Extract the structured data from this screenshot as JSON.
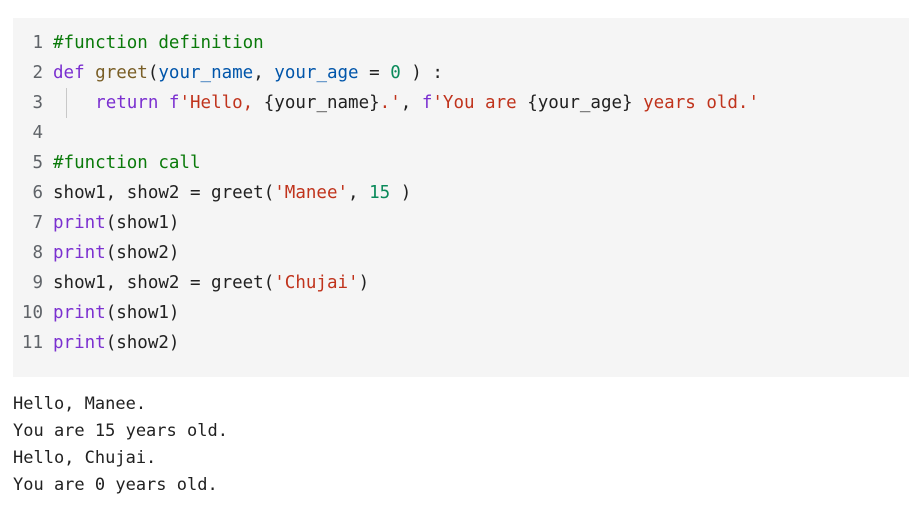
{
  "code_lines": [
    {
      "num": "1",
      "tokens": [
        [
          "comment",
          "#function definition"
        ]
      ]
    },
    {
      "num": "2",
      "tokens": [
        [
          "keyword",
          "def "
        ],
        [
          "func",
          "greet"
        ],
        [
          "plain",
          "("
        ],
        [
          "param",
          "your_name"
        ],
        [
          "plain",
          ", "
        ],
        [
          "param",
          "your_age"
        ],
        [
          "plain",
          " = "
        ],
        [
          "number",
          "0"
        ],
        [
          "plain",
          " ) :"
        ]
      ]
    },
    {
      "num": "3",
      "indent": true,
      "tokens": [
        [
          "plain",
          "    "
        ],
        [
          "keyword",
          "return "
        ],
        [
          "keyword",
          "f"
        ],
        [
          "string",
          "'Hello, "
        ],
        [
          "plain",
          "{your_name}"
        ],
        [
          "string",
          ".'"
        ],
        [
          "plain",
          ", "
        ],
        [
          "keyword",
          "f"
        ],
        [
          "string",
          "'You are "
        ],
        [
          "plain",
          "{your_age}"
        ],
        [
          "string",
          " years old.'"
        ]
      ]
    },
    {
      "num": "4",
      "tokens": []
    },
    {
      "num": "5",
      "tokens": [
        [
          "comment",
          "#function call"
        ]
      ]
    },
    {
      "num": "6",
      "tokens": [
        [
          "plain",
          "show1, show2 = greet("
        ],
        [
          "string",
          "'Manee'"
        ],
        [
          "plain",
          ", "
        ],
        [
          "number",
          "15"
        ],
        [
          "plain",
          " )"
        ]
      ]
    },
    {
      "num": "7",
      "tokens": [
        [
          "builtin",
          "print"
        ],
        [
          "plain",
          "(show1)"
        ]
      ]
    },
    {
      "num": "8",
      "tokens": [
        [
          "builtin",
          "print"
        ],
        [
          "plain",
          "(show2)"
        ]
      ]
    },
    {
      "num": "9",
      "tokens": [
        [
          "plain",
          "show1, show2 = greet("
        ],
        [
          "string",
          "'Chujai'"
        ],
        [
          "plain",
          ")"
        ]
      ]
    },
    {
      "num": "10",
      "tokens": [
        [
          "builtin",
          "print"
        ],
        [
          "plain",
          "(show1)"
        ]
      ]
    },
    {
      "num": "11",
      "tokens": [
        [
          "builtin",
          "print"
        ],
        [
          "plain",
          "(show2)"
        ]
      ]
    }
  ],
  "output_lines": [
    "Hello, Manee.",
    "You are 15 years old.",
    "Hello, Chujai.",
    "You are 0 years old."
  ],
  "colors": {
    "code_background": "#f5f5f5",
    "comment": "#0a7a0a",
    "keyword": "#7b30d0",
    "string": "#c0331c",
    "number": "#0a8a5a",
    "param": "#0055aa",
    "line_number": "#5f6368"
  }
}
